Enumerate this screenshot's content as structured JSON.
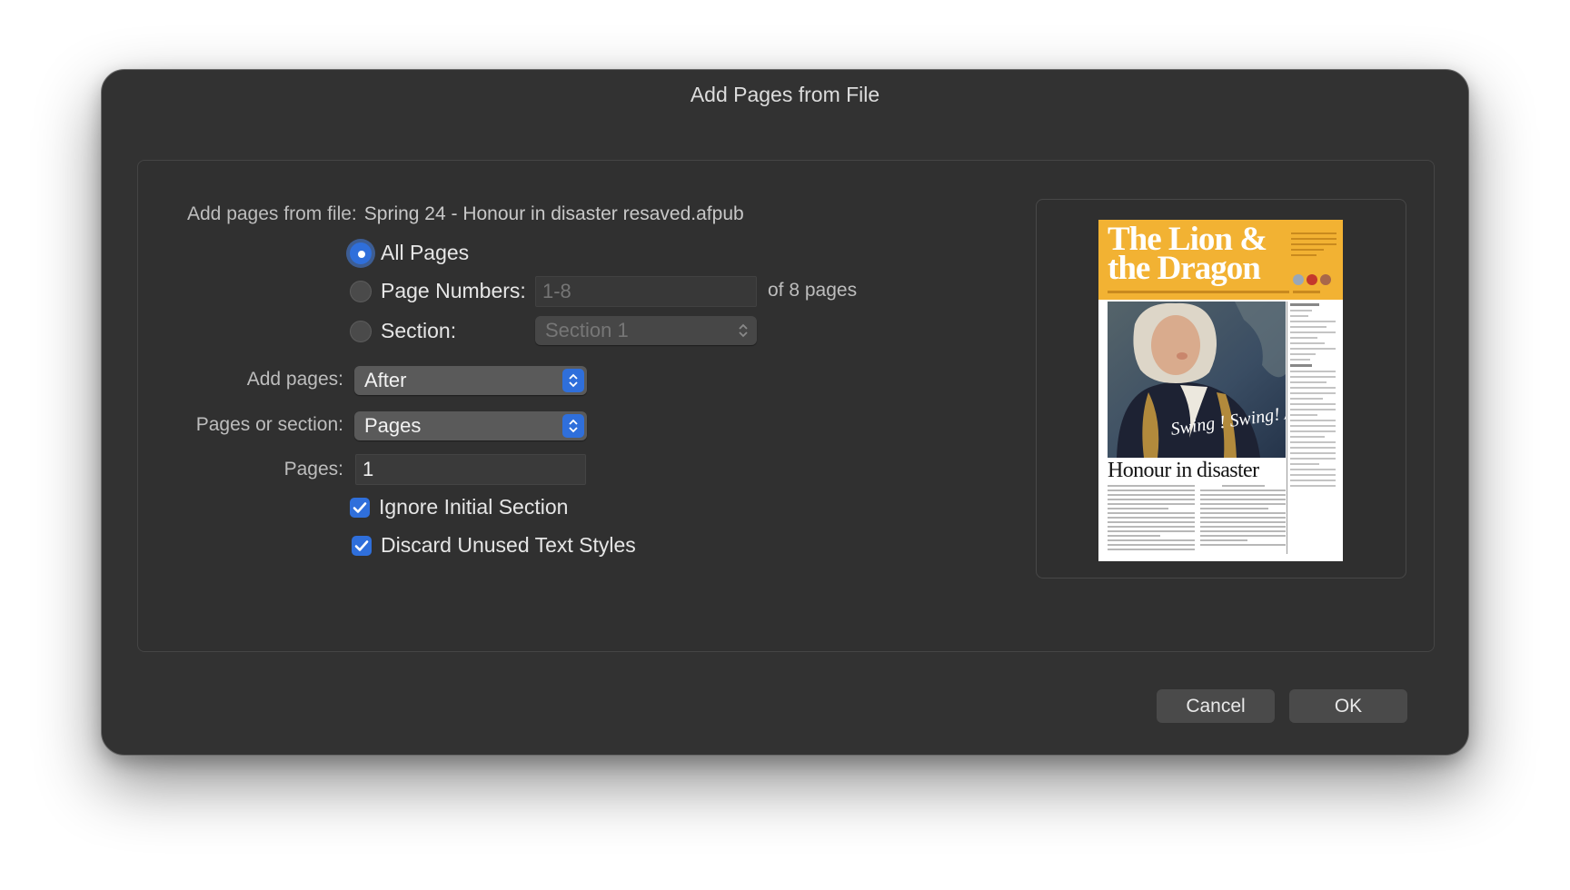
{
  "dialog": {
    "title": "Add Pages from File",
    "file_label": "Add pages from file:",
    "file_name": "Spring 24 - Honour in disaster resaved.afpub"
  },
  "page_range": {
    "all_pages_label": "All Pages",
    "page_numbers_label": "Page Numbers:",
    "page_numbers_placeholder": "1-8",
    "of_pages_text": "of 8 pages",
    "section_label": "Section:",
    "section_value": "Section 1",
    "selected": "all_pages"
  },
  "options": {
    "add_pages_label": "Add pages:",
    "add_pages_value": "After",
    "pages_or_section_label": "Pages or section:",
    "pages_or_section_value": "Pages",
    "pages_label": "Pages:",
    "pages_value": "1"
  },
  "checkboxes": {
    "ignore_initial_section": "Ignore Initial Section",
    "ignore_initial_section_checked": true,
    "discard_unused_text_styles": "Discard Unused Text Styles",
    "discard_unused_text_styles_checked": true
  },
  "preview": {
    "masthead_title": "The Lion & the Dragon",
    "portrait_caption": "Swing ! Swing! Admiral Byng!",
    "headline": "Honour in disaster"
  },
  "buttons": {
    "cancel_label": "Cancel",
    "ok_label": "OK"
  },
  "colors": {
    "dialog_background": "#323232",
    "accent_blue": "#2f6fdb",
    "masthead_gold": "#f2b233"
  }
}
